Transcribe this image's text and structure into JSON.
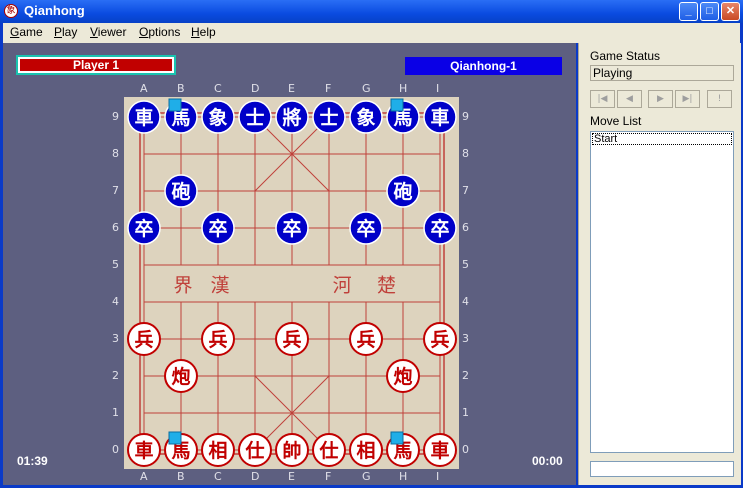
{
  "window": {
    "title": "Qianhong",
    "icon": "qianhong-app-icon",
    "icon_glyph": "象",
    "controls": {
      "minimize": "_",
      "maximize": "□",
      "close": "✕"
    }
  },
  "menu": [
    {
      "key": "game",
      "label": "Game",
      "accel": "G",
      "rest": "ame"
    },
    {
      "key": "play",
      "label": "Play",
      "accel": "P",
      "rest": "lay"
    },
    {
      "key": "viewer",
      "label": "Viewer",
      "accel": "V",
      "rest": "iewer"
    },
    {
      "key": "options",
      "label": "Options",
      "accel": "O",
      "rest": "ptions"
    },
    {
      "key": "help",
      "label": "Help",
      "accel": "H",
      "rest": "elp"
    }
  ],
  "players": {
    "red": {
      "name": "Player 1",
      "time": "01:39",
      "color": "#c10000"
    },
    "blue": {
      "name": "Qianhong-1",
      "time": "00:00",
      "color": "#0a00e6"
    }
  },
  "board": {
    "files": [
      "A",
      "B",
      "C",
      "D",
      "E",
      "F",
      "G",
      "H",
      "I"
    ],
    "ranks": [
      "0",
      "1",
      "2",
      "3",
      "4",
      "5",
      "6",
      "7",
      "8",
      "9"
    ],
    "river_left": [
      "界",
      "漢"
    ],
    "river_right": [
      "河",
      "楚"
    ],
    "colors": {
      "board": "#ddd3be",
      "lines": "#c0403a",
      "red": "#c10000",
      "blue": "#0000c8",
      "highlight": "#1faee8"
    },
    "pieces": [
      {
        "side": "blue",
        "glyph": "車",
        "file": 0,
        "rank": 9
      },
      {
        "side": "blue",
        "glyph": "馬",
        "file": 1,
        "rank": 9
      },
      {
        "side": "blue",
        "glyph": "象",
        "file": 2,
        "rank": 9
      },
      {
        "side": "blue",
        "glyph": "士",
        "file": 3,
        "rank": 9
      },
      {
        "side": "blue",
        "glyph": "將",
        "file": 4,
        "rank": 9
      },
      {
        "side": "blue",
        "glyph": "士",
        "file": 5,
        "rank": 9
      },
      {
        "side": "blue",
        "glyph": "象",
        "file": 6,
        "rank": 9
      },
      {
        "side": "blue",
        "glyph": "馬",
        "file": 7,
        "rank": 9
      },
      {
        "side": "blue",
        "glyph": "車",
        "file": 8,
        "rank": 9
      },
      {
        "side": "blue",
        "glyph": "砲",
        "file": 1,
        "rank": 7
      },
      {
        "side": "blue",
        "glyph": "砲",
        "file": 7,
        "rank": 7
      },
      {
        "side": "blue",
        "glyph": "卒",
        "file": 0,
        "rank": 6
      },
      {
        "side": "blue",
        "glyph": "卒",
        "file": 2,
        "rank": 6
      },
      {
        "side": "blue",
        "glyph": "卒",
        "file": 4,
        "rank": 6
      },
      {
        "side": "blue",
        "glyph": "卒",
        "file": 6,
        "rank": 6
      },
      {
        "side": "blue",
        "glyph": "卒",
        "file": 8,
        "rank": 6
      },
      {
        "side": "red",
        "glyph": "兵",
        "file": 0,
        "rank": 3
      },
      {
        "side": "red",
        "glyph": "兵",
        "file": 2,
        "rank": 3
      },
      {
        "side": "red",
        "glyph": "兵",
        "file": 4,
        "rank": 3
      },
      {
        "side": "red",
        "glyph": "兵",
        "file": 6,
        "rank": 3
      },
      {
        "side": "red",
        "glyph": "兵",
        "file": 8,
        "rank": 3
      },
      {
        "side": "red",
        "glyph": "炮",
        "file": 1,
        "rank": 2
      },
      {
        "side": "red",
        "glyph": "炮",
        "file": 7,
        "rank": 2
      },
      {
        "side": "red",
        "glyph": "車",
        "file": 0,
        "rank": 0
      },
      {
        "side": "red",
        "glyph": "馬",
        "file": 1,
        "rank": 0
      },
      {
        "side": "red",
        "glyph": "相",
        "file": 2,
        "rank": 0
      },
      {
        "side": "red",
        "glyph": "仕",
        "file": 3,
        "rank": 0
      },
      {
        "side": "red",
        "glyph": "帥",
        "file": 4,
        "rank": 0
      },
      {
        "side": "red",
        "glyph": "仕",
        "file": 5,
        "rank": 0
      },
      {
        "side": "red",
        "glyph": "相",
        "file": 6,
        "rank": 0
      },
      {
        "side": "red",
        "glyph": "馬",
        "file": 7,
        "rank": 0
      },
      {
        "side": "red",
        "glyph": "車",
        "file": 8,
        "rank": 0
      }
    ],
    "highlights": [
      {
        "file": 1,
        "rank": 9
      },
      {
        "file": 7,
        "rank": 9
      },
      {
        "file": 1,
        "rank": 0
      },
      {
        "file": 7,
        "rank": 0
      }
    ]
  },
  "sidebar": {
    "status_label": "Game Status",
    "status_value": "Playing",
    "nav_buttons": [
      {
        "key": "first",
        "icon": "first-move-icon",
        "glyph": "|◀"
      },
      {
        "key": "prev",
        "icon": "prev-move-icon",
        "glyph": "◀"
      },
      {
        "key": "next",
        "icon": "next-move-icon",
        "glyph": "▶"
      },
      {
        "key": "last",
        "icon": "last-move-icon",
        "glyph": "▶|"
      },
      {
        "key": "hint",
        "icon": "exclamation-icon",
        "glyph": "!"
      }
    ],
    "movelist_label": "Move List",
    "moves": [
      "Start"
    ]
  }
}
